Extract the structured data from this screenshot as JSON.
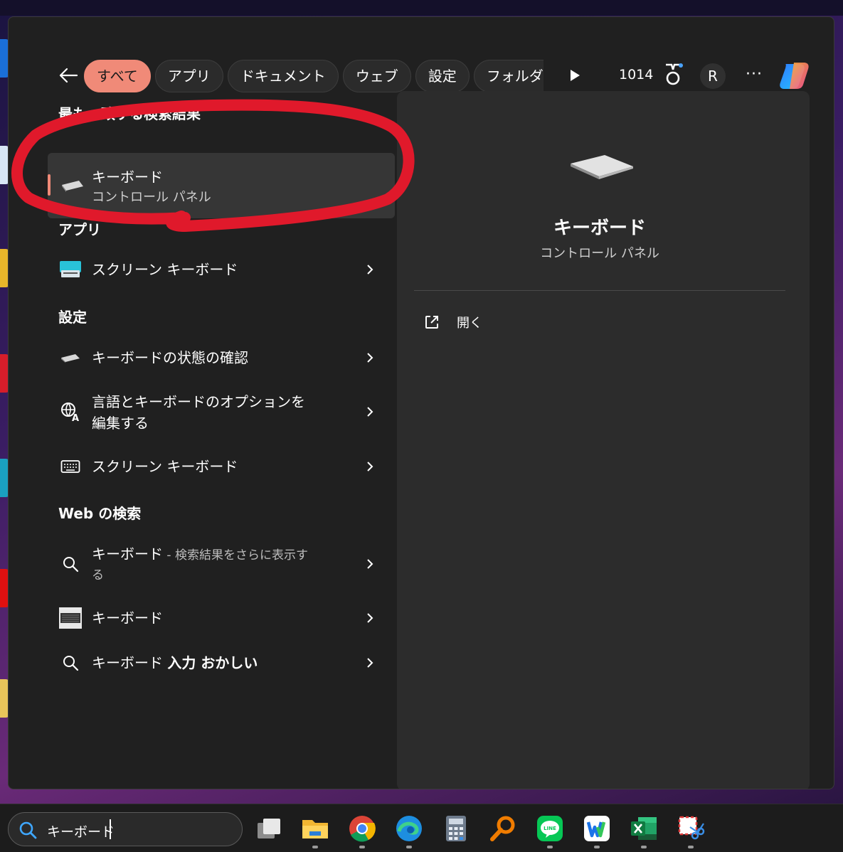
{
  "filter_bar": {
    "back_label": "←",
    "tabs": [
      {
        "label": "すべて",
        "active": true
      },
      {
        "label": "アプリ",
        "active": false
      },
      {
        "label": "ドキュメント",
        "active": false
      },
      {
        "label": "ウェブ",
        "active": false
      },
      {
        "label": "設定",
        "active": false
      },
      {
        "label": "フォルダー",
        "active": false
      }
    ],
    "points": "1014",
    "avatar_initial": "R",
    "more_label": "···"
  },
  "results": {
    "best_match_heading": "最も一致する検索結果",
    "best_match": {
      "title": "キーボード",
      "subtitle": "コントロール パネル",
      "icon": "keyboard-icon"
    },
    "apps_heading": "アプリ",
    "apps": [
      {
        "label": "スクリーン キーボード",
        "icon": "onscreen-keyboard-app-icon"
      }
    ],
    "settings_heading": "設定",
    "settings": [
      {
        "label": "キーボードの状態の確認",
        "icon": "keyboard-icon"
      },
      {
        "label": "言語とキーボードのオプションを",
        "label_line2": "編集する",
        "icon": "language-icon"
      },
      {
        "label": "スクリーン キーボード",
        "icon": "keyboard-outline-icon"
      }
    ],
    "web_heading": "Web の検索",
    "web": [
      {
        "label": "キーボード",
        "suffix": " - 検索結果をさらに表示す",
        "suffix_line2": "る",
        "icon": "search-icon"
      },
      {
        "label": "キーボード",
        "icon": "keyboard-photo-icon"
      },
      {
        "label": "キーボード ",
        "bold": "入力 おかしい",
        "icon": "search-icon"
      }
    ]
  },
  "preview": {
    "title": "キーボード",
    "subtitle": "コントロール パネル",
    "action_label": "開く"
  },
  "taskbar": {
    "search_value": "キーボード",
    "apps": [
      "task-view",
      "file-explorer",
      "chrome",
      "edge",
      "calculator",
      "search-tool",
      "line",
      "word-app",
      "excel",
      "snipping-tool"
    ]
  },
  "colors": {
    "accent": "#f08a78",
    "annotation_red": "#e0192b",
    "panel_bg": "#202020",
    "preview_bg": "#2c2c2c"
  }
}
